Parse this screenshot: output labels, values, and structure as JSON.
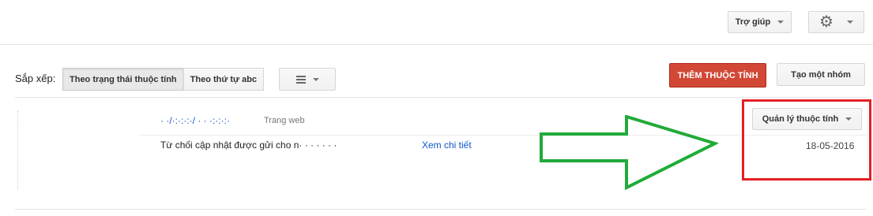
{
  "header": {
    "help_label": "Trợ giúp",
    "settings_icon": "gear-icon"
  },
  "toolbar": {
    "sort_label": "Sắp xếp:",
    "sort_options": [
      "Theo trạng thái thuộc tính",
      "Theo thứ tự abc"
    ],
    "sort_active": "Theo trạng thái thuộc tính",
    "view_icon": "list-view-icon",
    "add_property_label": "THÊM THUỘC TÍNH",
    "create_group_label": "Tạo một nhóm"
  },
  "property": {
    "site_link": "· ·/·:·:·:·/ ·  · ·:·:·:·",
    "site_type": "Trang web",
    "manage_label": "Quản lý thuộc tính",
    "message": "Từ chối cập nhật được gửi cho n·      ·  ·  · ·  · ·",
    "detail_link": "Xem chi tiết",
    "date": "18-05-2016"
  },
  "annotation": {
    "arrow_color": "#22aa3a",
    "box_color": "#e32026"
  }
}
